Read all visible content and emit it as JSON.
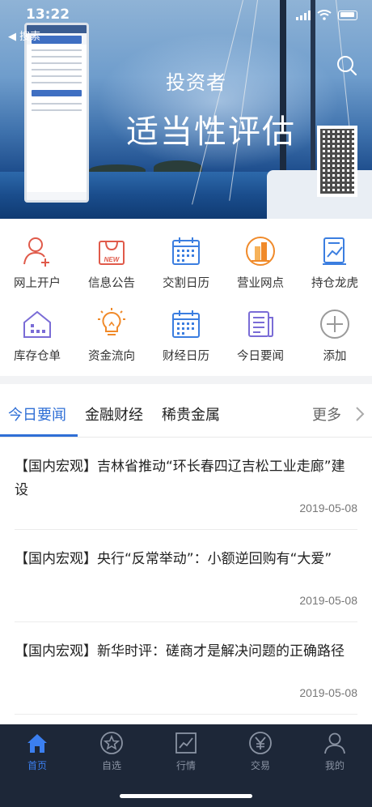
{
  "status_bar": {
    "time": "13:22",
    "back_label": "◀ 搜索"
  },
  "banner": {
    "line1": "投资者",
    "line2": "适当性评估",
    "search_icon": "search-icon",
    "qr_icon": "qr-code-icon"
  },
  "menu": {
    "row1": [
      {
        "label": "网上开户",
        "icon": "user-add-icon",
        "color": "#e05a4a"
      },
      {
        "label": "信息公告",
        "icon": "bag-new-icon",
        "color": "#e05a4a"
      },
      {
        "label": "交割日历",
        "icon": "calendar-icon",
        "color": "#3b7ee0"
      },
      {
        "label": "营业网点",
        "icon": "building-icon",
        "color": "#f08a2a"
      },
      {
        "label": "持仓龙虎",
        "icon": "chart-doc-icon",
        "color": "#3b7ee0"
      }
    ],
    "row2": [
      {
        "label": "库存仓单",
        "icon": "warehouse-icon",
        "color": "#7a6cd6"
      },
      {
        "label": "资金流向",
        "icon": "bulb-icon",
        "color": "#f08a2a"
      },
      {
        "label": "财经日历",
        "icon": "calendar-icon",
        "color": "#3b7ee0"
      },
      {
        "label": "今日要闻",
        "icon": "newspaper-icon",
        "color": "#7a6cd6"
      },
      {
        "label": "添加",
        "icon": "plus-circle-icon",
        "color": "#9a9a9a"
      }
    ]
  },
  "tabs": {
    "items": [
      "今日要闻",
      "金融财经",
      "稀贵金属"
    ],
    "more": "更多"
  },
  "news": [
    {
      "title": "【国内宏观】吉林省推动“环长春四辽吉松工业走廊”建设",
      "date": "2019-05-08"
    },
    {
      "title": "【国内宏观】央行“反常举动”：小额逆回购有“大爱”",
      "date": "2019-05-08"
    },
    {
      "title": "【国内宏观】新华时评：磋商才是解决问题的正确路径",
      "date": "2019-05-08"
    }
  ],
  "bottom_nav": [
    {
      "label": "首页",
      "icon": "home-icon",
      "active": true
    },
    {
      "label": "自选",
      "icon": "star-circle-icon",
      "active": false
    },
    {
      "label": "行情",
      "icon": "chart-line-icon",
      "active": false
    },
    {
      "label": "交易",
      "icon": "yen-circle-icon",
      "active": false
    },
    {
      "label": "我的",
      "icon": "user-icon",
      "active": false
    }
  ],
  "colors": {
    "accent": "#2f6fd6",
    "nav_bg": "#1d2738"
  }
}
